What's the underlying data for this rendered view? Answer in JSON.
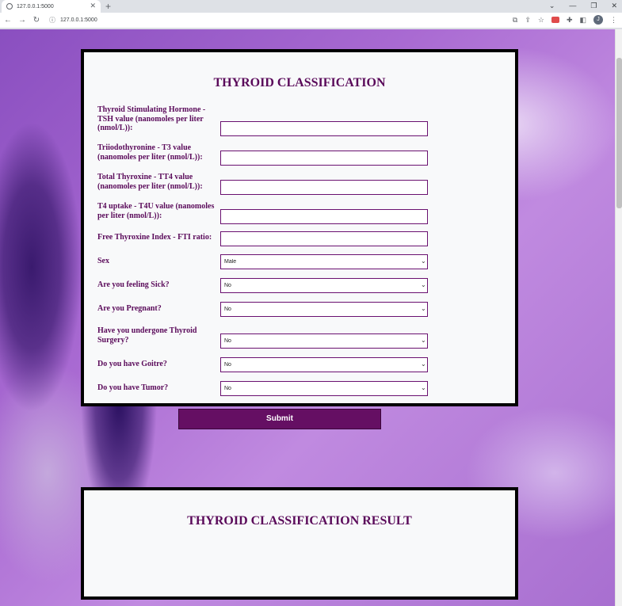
{
  "browser": {
    "tab_title": "127.0.0.1:5000",
    "url": "127.0.0.1:5000",
    "profile_initial": "J"
  },
  "form": {
    "title": "THYROID CLASSIFICATION",
    "fields": [
      {
        "label": "Thyroid Stimulating Hormone - TSH value (nanomoles per liter (nmol/L)):",
        "value": ""
      },
      {
        "label": "Triiodothyronine - T3 value (nanomoles per liter (nmol/L)):",
        "value": ""
      },
      {
        "label": "Total Thyroxine - TT4 value (nanomoles per liter (nmol/L)):",
        "value": ""
      },
      {
        "label": "T4 uptake - T4U value (nanomoles per liter (nmol/L)):",
        "value": ""
      },
      {
        "label": "Free Thyroxine Index - FTI ratio:",
        "value": ""
      }
    ],
    "selects": [
      {
        "label": "Sex",
        "value": "Male"
      },
      {
        "label": "Are you feeling Sick?",
        "value": "No"
      },
      {
        "label": "Are you Pregnant?",
        "value": "No"
      },
      {
        "label": "Have you undergone Thyroid Surgery?",
        "value": "No"
      },
      {
        "label": "Do you have Goitre?",
        "value": "No"
      },
      {
        "label": "Do you have Tumor?",
        "value": "No"
      }
    ],
    "submit_label": "Submit"
  },
  "result": {
    "title": "THYROID CLASSIFICATION RESULT"
  },
  "colors": {
    "accent": "#650f63",
    "label_text": "#5a0a5a"
  }
}
